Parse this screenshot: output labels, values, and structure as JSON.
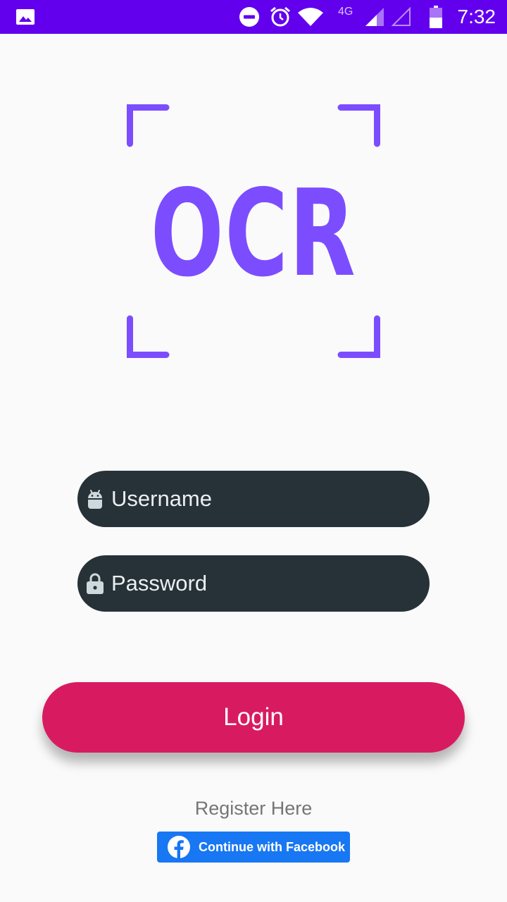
{
  "status_bar": {
    "time": "7:32",
    "network_type": "4G",
    "icons": [
      "image-icon",
      "do-not-disturb-icon",
      "alarm-icon",
      "wifi-icon",
      "signal-icon",
      "signal-empty-icon",
      "battery-icon"
    ],
    "background_color": "#6200ee"
  },
  "logo": {
    "text": "OCR",
    "color": "#7c4dff"
  },
  "form": {
    "username": {
      "placeholder": "Username",
      "value": "",
      "icon": "android-icon"
    },
    "password": {
      "placeholder": "Password",
      "value": "",
      "icon": "lock-icon"
    },
    "field_color": "#263238"
  },
  "login_button": {
    "label": "Login",
    "color": "#d81b60"
  },
  "register_link": {
    "label": "Register Here"
  },
  "facebook_button": {
    "label": "Continue with Facebook",
    "icon": "facebook-icon",
    "color": "#1877f2"
  }
}
